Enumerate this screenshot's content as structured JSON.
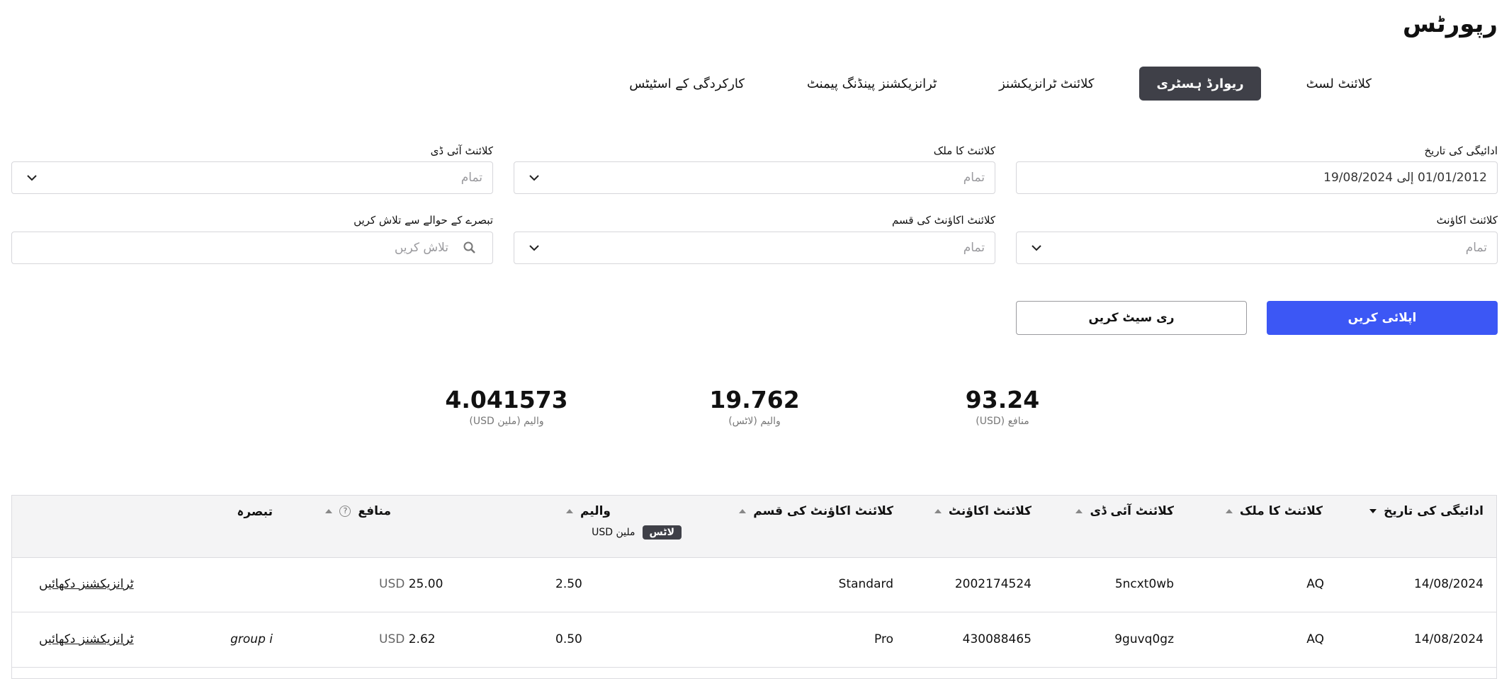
{
  "page": {
    "title": "رپورٹس"
  },
  "tabs": [
    {
      "label": "کلائنٹ لسٹ",
      "active": false
    },
    {
      "label": "ریوارڈ ہسٹری",
      "active": true
    },
    {
      "label": "کلائنٹ ٹرانزیکشنز",
      "active": false
    },
    {
      "label": "ٹرانزیکشنز پینڈنگ پیمنٹ",
      "active": false
    },
    {
      "label": "کارکردگی کے اسٹیٹس",
      "active": false
    }
  ],
  "filters": {
    "payment_date": {
      "label": "ادائیگی کی تاریخ",
      "value": "01/01/2012 إلى 19/08/2024"
    },
    "client_country": {
      "label": "کلائنٹ کا ملک",
      "placeholder": "تمام"
    },
    "client_id": {
      "label": "کلائنٹ آئی ڈی",
      "placeholder": "تمام"
    },
    "client_account": {
      "label": "کلائنٹ اکاؤنٹ",
      "placeholder": "تمام"
    },
    "account_type": {
      "label": "کلائنٹ اکاؤنٹ کی قسم",
      "placeholder": "تمام"
    },
    "comment_search": {
      "label": "تبصرے کے حوالے سے تلاش کریں",
      "placeholder": "تلاش کریں"
    }
  },
  "buttons": {
    "apply": "اپلائی کریں",
    "reset": "ری سیٹ کریں"
  },
  "stats": [
    {
      "value": "93.24",
      "label": "منافع (USD)"
    },
    {
      "value": "19.762",
      "label": "والیم (لاٹس)"
    },
    {
      "value": "4.041573",
      "label": "والیم (ملین USD)"
    }
  ],
  "table": {
    "headers": {
      "payment_date": "ادائیگی کی تاریخ",
      "country": "کلائنٹ کا ملک",
      "client_id": "کلائنٹ آئی ڈی",
      "account": "کلائنٹ اکاؤنٹ",
      "account_type": "کلائنٹ اکاؤنٹ کی قسم",
      "volume": "والیم",
      "profit": "منافع",
      "comment": "تبصرہ"
    },
    "help_icon": "?",
    "volume_units": {
      "active": "لاٹس",
      "inactive": "ملین USD"
    },
    "rows": [
      {
        "date": "14/08/2024",
        "country": "AQ",
        "client_id": "5ncxt0wb",
        "account": "2002174524",
        "type": "Standard",
        "volume": "2.50",
        "currency": "USD",
        "profit": "25.00",
        "comment": "",
        "action": "ٹرانزیکشنز دکھائیں"
      },
      {
        "date": "14/08/2024",
        "country": "AQ",
        "client_id": "9guvq0gz",
        "account": "430088465",
        "type": "Pro",
        "volume": "0.50",
        "currency": "USD",
        "profit": "2.62",
        "comment": "group i",
        "action": "ٹرانزیکشنز دکھائیں"
      }
    ]
  }
}
